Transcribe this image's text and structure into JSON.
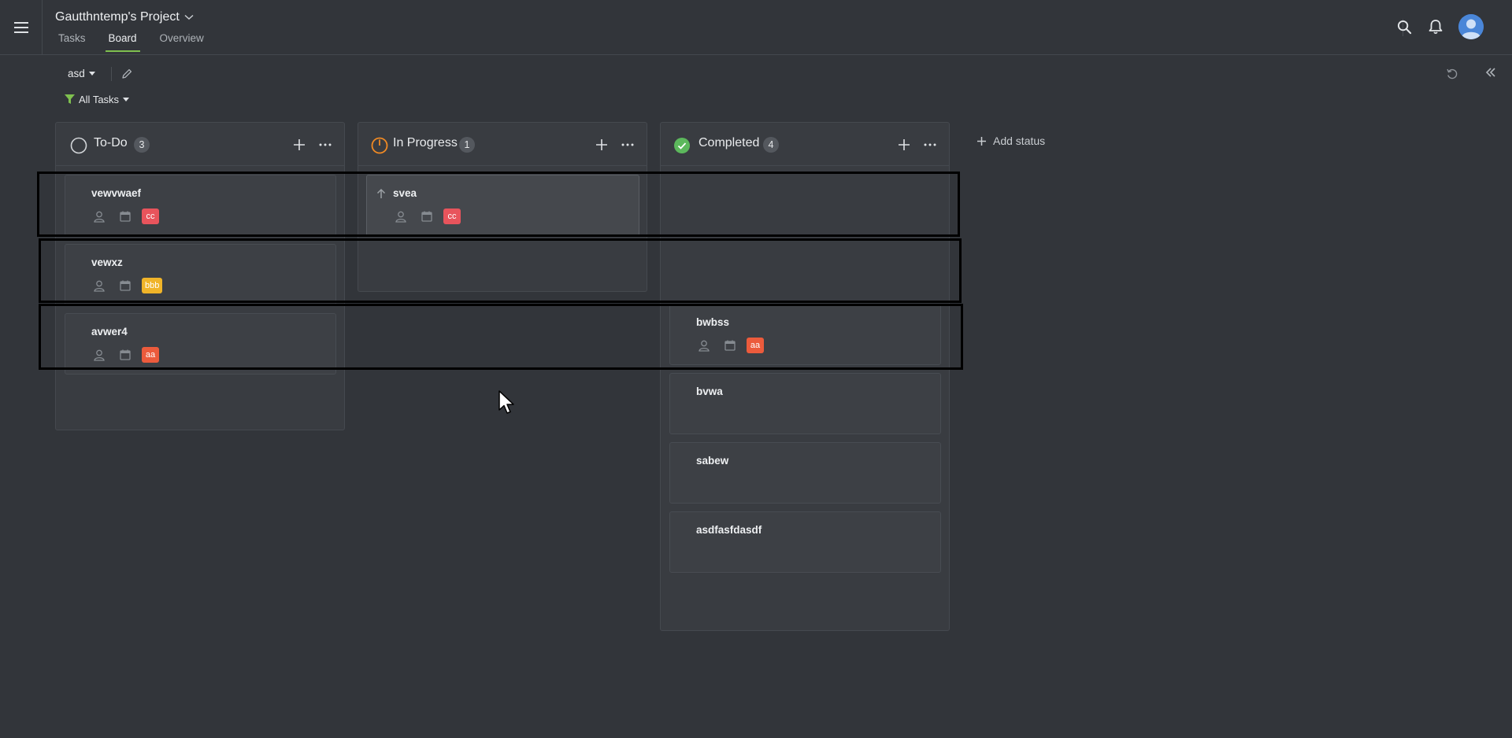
{
  "header": {
    "project_title": "Gautthntemp's Project",
    "tabs": [
      {
        "label": "Tasks",
        "active": false
      },
      {
        "label": "Board",
        "active": true
      },
      {
        "label": "Overview",
        "active": false
      }
    ],
    "icons": [
      "menu-icon",
      "search-icon",
      "bell-icon",
      "user-avatar-icon"
    ]
  },
  "toolbar": {
    "view_name": "asd",
    "filter_label": "All Tasks",
    "icons": [
      "edit-icon",
      "refresh-icon",
      "collapse-panel-icon"
    ]
  },
  "board": {
    "add_status_label": "Add status",
    "columns": [
      {
        "title": "To-Do",
        "count": "3",
        "status_icon": "empty-circle-icon",
        "cards": [
          {
            "title": "vewvwaef",
            "tag": "cc",
            "tag_color": "#e8545c"
          },
          {
            "title": "vewxz",
            "tag": "bbb",
            "tag_color": "#f0b429"
          },
          {
            "title": "avwer4",
            "tag": "aa",
            "tag_color": "#ec5b3c"
          }
        ]
      },
      {
        "title": "In Progress",
        "count": "1",
        "status_icon": "progress-circle-icon",
        "cards": [
          {
            "title": "svea",
            "tag": "cc",
            "tag_color": "#e8545c",
            "priority_icon": "arrow-up-icon"
          }
        ]
      },
      {
        "title": "Completed",
        "count": "4",
        "status_icon": "check-circle-icon",
        "cards": [
          {
            "title": "bwbss",
            "tag": "aa",
            "tag_color": "#ec5b3c"
          },
          {
            "title": "bvwa"
          },
          {
            "title": "sabew"
          },
          {
            "title": "asdfasfdasdf"
          }
        ]
      }
    ]
  },
  "colors": {
    "background": "#32353a",
    "accent_green": "#7fc04f",
    "in_progress_orange": "#f08a24",
    "completed_green": "#5cb85c",
    "filter_green": "#7fc04f"
  }
}
